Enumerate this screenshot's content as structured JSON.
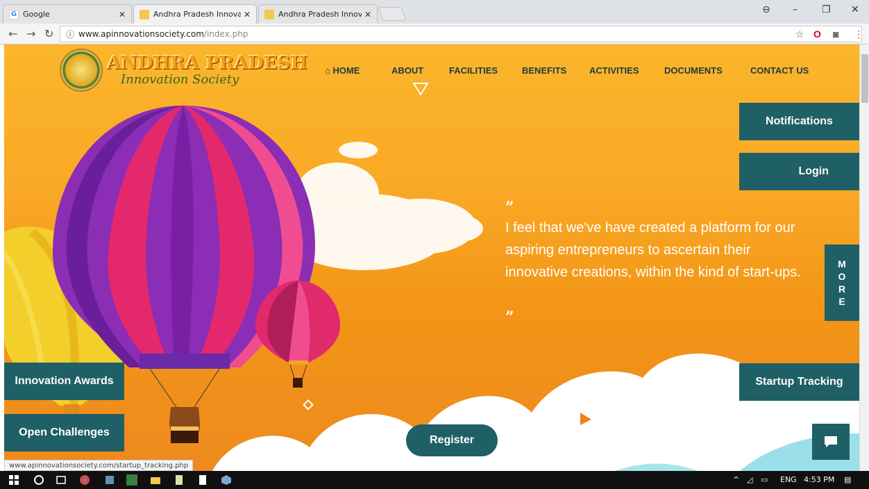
{
  "browser": {
    "tabs": [
      {
        "label": "Google",
        "icon": "google-icon",
        "active": false
      },
      {
        "label": "Andhra Pradesh Innovatio",
        "icon": "site-favicon",
        "active": true
      },
      {
        "label": "Andhra Pradesh Innovatio",
        "icon": "site-favicon",
        "active": false
      }
    ],
    "url_host": "www.apinnovationsociety.com",
    "url_path": "/index.php",
    "status_url": "www.apinnovationsociety.com/startup_tracking.php"
  },
  "site": {
    "logo_title": "ANDHRA PRADESH",
    "logo_subtitle": "Innovation Society",
    "nav": {
      "home": "HOME",
      "about": "ABOUT",
      "facilities": "FACILITIES",
      "benefits": "BENEFITS",
      "activities": "ACTIVITIES",
      "documents": "DOCUMENTS",
      "contact": "CONTACT US"
    },
    "buttons": {
      "notifications": "Notifications",
      "login": "Login",
      "more_letters": [
        "M",
        "O",
        "R",
        "E"
      ],
      "innovation_awards": "Innovation Awards",
      "open_challenges": "Open Challenges",
      "startup_tracking": "Startup Tracking",
      "register": "Register"
    },
    "quote_open": "”",
    "quote_close": "”",
    "quote": "I feel that we've have created a platform for our aspiring entrepreneurs to ascertain their innovative creations, within the kind of start-ups."
  },
  "taskbar": {
    "lang": "ENG",
    "time": "4:53 PM"
  },
  "colors": {
    "accent_teal": "#1f5f66",
    "background_orange": "#f9a825"
  }
}
